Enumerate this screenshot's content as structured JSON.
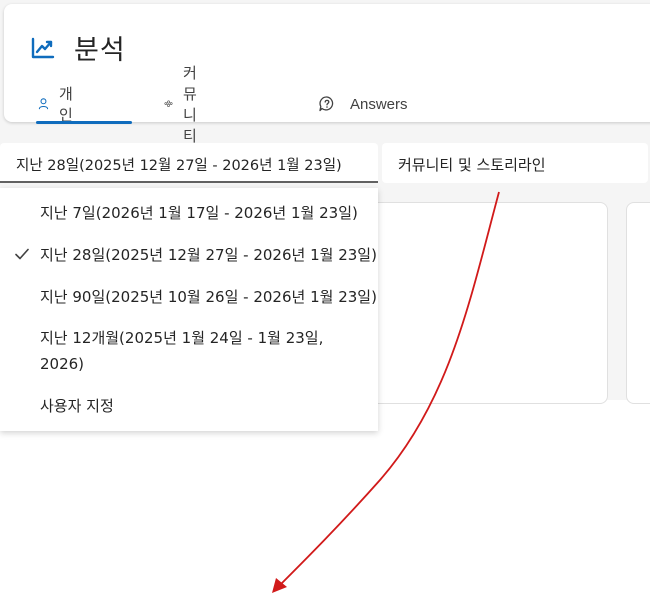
{
  "header": {
    "title": "분석",
    "tabs": [
      {
        "label": "개인",
        "icon": "person-icon",
        "active": true
      },
      {
        "label": "커뮤니티",
        "icon": "people-community-icon",
        "active": false
      },
      {
        "label": "Answers",
        "icon": "question-chat-icon",
        "active": false
      }
    ]
  },
  "filters": {
    "date_range": "지난 28일(2025년 12월 27일 - 2026년 1월 23일)",
    "scope": "커뮤니티 및 스토리라인"
  },
  "dropdown": {
    "options": [
      {
        "label": "지난 7일(2026년 1월 17일 - 2026년 1월 23일)",
        "selected": false
      },
      {
        "label": "지난 28일(2025년 12월 27일 - 2026년 1월 23일)",
        "selected": true
      },
      {
        "label": "지난 90일(2025년 10월 26일 - 2026년 1월 23일)",
        "selected": false
      },
      {
        "label": "지난 12개월(2025년 1월 24일 - 1월 23일, 2026)",
        "selected": false
      },
      {
        "label": "사용자 지정",
        "selected": false
      }
    ]
  },
  "colors": {
    "accent": "#0f6cbd",
    "annotation_arrow": "#d11a1a"
  }
}
